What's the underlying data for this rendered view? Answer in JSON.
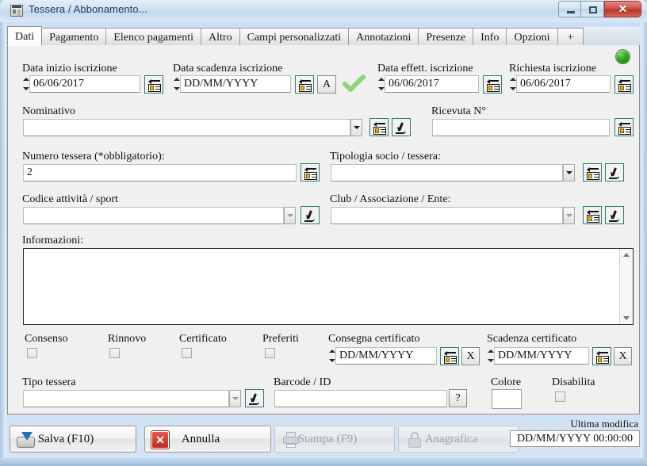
{
  "window": {
    "title": "Tessera / Abbonamento...",
    "icon": "card-window-icon",
    "minimize_label": "",
    "maximize_label": "",
    "close_label": "✕"
  },
  "tabs": [
    {
      "label": "Dati",
      "active": true
    },
    {
      "label": "Pagamento",
      "active": false
    },
    {
      "label": "Elenco pagamenti",
      "active": false
    },
    {
      "label": "Altro",
      "active": false
    },
    {
      "label": "Campi personalizzati",
      "active": false
    },
    {
      "label": "Annotazioni",
      "active": false
    },
    {
      "label": "Presenze",
      "active": false
    },
    {
      "label": "Info",
      "active": false
    },
    {
      "label": "Opzioni",
      "active": false
    },
    {
      "label": "+",
      "active": false
    }
  ],
  "status_led": {
    "name": "status-led",
    "color": "#2fa321"
  },
  "form": {
    "data_inizio": {
      "label": "Data inizio iscrizione",
      "value": "06/06/2017"
    },
    "data_scadenza": {
      "label": "Data scadenza iscrizione",
      "value": "DD/MM/YYYY",
      "extra_button": "A"
    },
    "data_effett": {
      "label": "Data effett. iscrizione",
      "value": "06/06/2017"
    },
    "richiesta": {
      "label": "Richiesta iscrizione",
      "value": "06/06/2017"
    },
    "valid_check": "green-check-icon",
    "nominativo": {
      "label": "Nominativo",
      "value": ""
    },
    "ricevuta": {
      "label": "Ricevuta N°",
      "value": ""
    },
    "numero_tessera": {
      "label": "Numero tessera (*obbligatorio):",
      "value": "2"
    },
    "tipologia_socio": {
      "label": "Tipologia socio / tessera:",
      "value": ""
    },
    "codice_attivita": {
      "label": "Codice attività / sport",
      "value": ""
    },
    "club": {
      "label": "Club / Associazione / Ente:",
      "value": ""
    },
    "informazioni": {
      "label": "Informazioni:",
      "value": ""
    },
    "checkboxes": [
      {
        "label": "Consenso",
        "checked": false
      },
      {
        "label": "Rinnovo",
        "checked": false
      },
      {
        "label": "Certificato",
        "checked": false
      },
      {
        "label": "Preferiti",
        "checked": false
      }
    ],
    "consegna_certificato": {
      "label": "Consegna certificato",
      "value": "DD/MM/YYYY",
      "clear_button": "X"
    },
    "scadenza_certificato": {
      "label": "Scadenza certificato",
      "value": "DD/MM/YYYY",
      "clear_button": "X"
    },
    "tipo_tessera": {
      "label": "Tipo tessera",
      "value": ""
    },
    "barcode": {
      "label": "Barcode / ID",
      "value": "",
      "help_button": "?"
    },
    "colore": {
      "label": "Colore",
      "value": ""
    },
    "disabilita": {
      "label": "Disabilita",
      "checked": false
    }
  },
  "footer": {
    "save": {
      "label": "Salva (F10)",
      "icon": "save-disk-icon",
      "disabled": false
    },
    "cancel": {
      "label": "Annulla",
      "icon": "red-x-icon",
      "disabled": false
    },
    "print": {
      "label": "Stampa (F9)",
      "icon": "printer-icon",
      "disabled": true
    },
    "anagrafica": {
      "label": "Anagrafica",
      "icon": "lock-icon",
      "disabled": true
    },
    "ultima_modifica": {
      "label": "Ultima modifica",
      "value": "DD/MM/YYYY 00:00:00"
    }
  }
}
